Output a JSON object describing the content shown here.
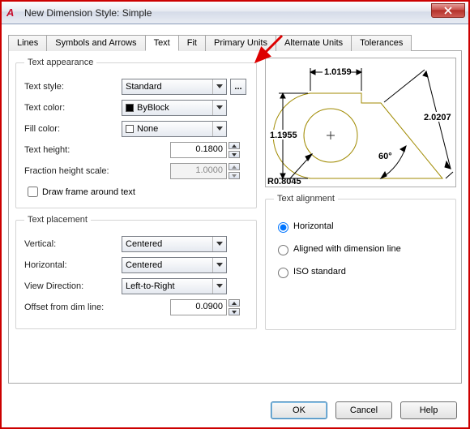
{
  "window": {
    "title": "New Dimension Style: Simple"
  },
  "tabs": [
    "Lines",
    "Symbols and Arrows",
    "Text",
    "Fit",
    "Primary Units",
    "Alternate Units",
    "Tolerances"
  ],
  "active_tab": "Text",
  "appearance": {
    "legend": "Text appearance",
    "style_label": "Text style:",
    "style_value": "Standard",
    "ellipsis": "...",
    "color_label": "Text color:",
    "color_value": "ByBlock",
    "fill_label": "Fill color:",
    "fill_value": "None",
    "height_label": "Text height:",
    "height_value": "0.1800",
    "fraction_label": "Fraction height scale:",
    "fraction_value": "1.0000",
    "frame_label": "Draw frame around text"
  },
  "placement": {
    "legend": "Text placement",
    "vertical_label": "Vertical:",
    "vertical_value": "Centered",
    "horizontal_label": "Horizontal:",
    "horizontal_value": "Centered",
    "viewdir_label": "View Direction:",
    "viewdir_value": "Left-to-Right",
    "offset_label": "Offset from dim line:",
    "offset_value": "0.0900"
  },
  "alignment": {
    "legend": "Text alignment",
    "opt_horizontal": "Horizontal",
    "opt_aligned": "Aligned with dimension line",
    "opt_iso": "ISO standard"
  },
  "preview_labels": {
    "top": "1.0159",
    "left": "1.1955",
    "right": "2.0207",
    "angle": "60°",
    "radius": "R0.8045"
  },
  "buttons": {
    "ok": "OK",
    "cancel": "Cancel",
    "help": "Help"
  }
}
